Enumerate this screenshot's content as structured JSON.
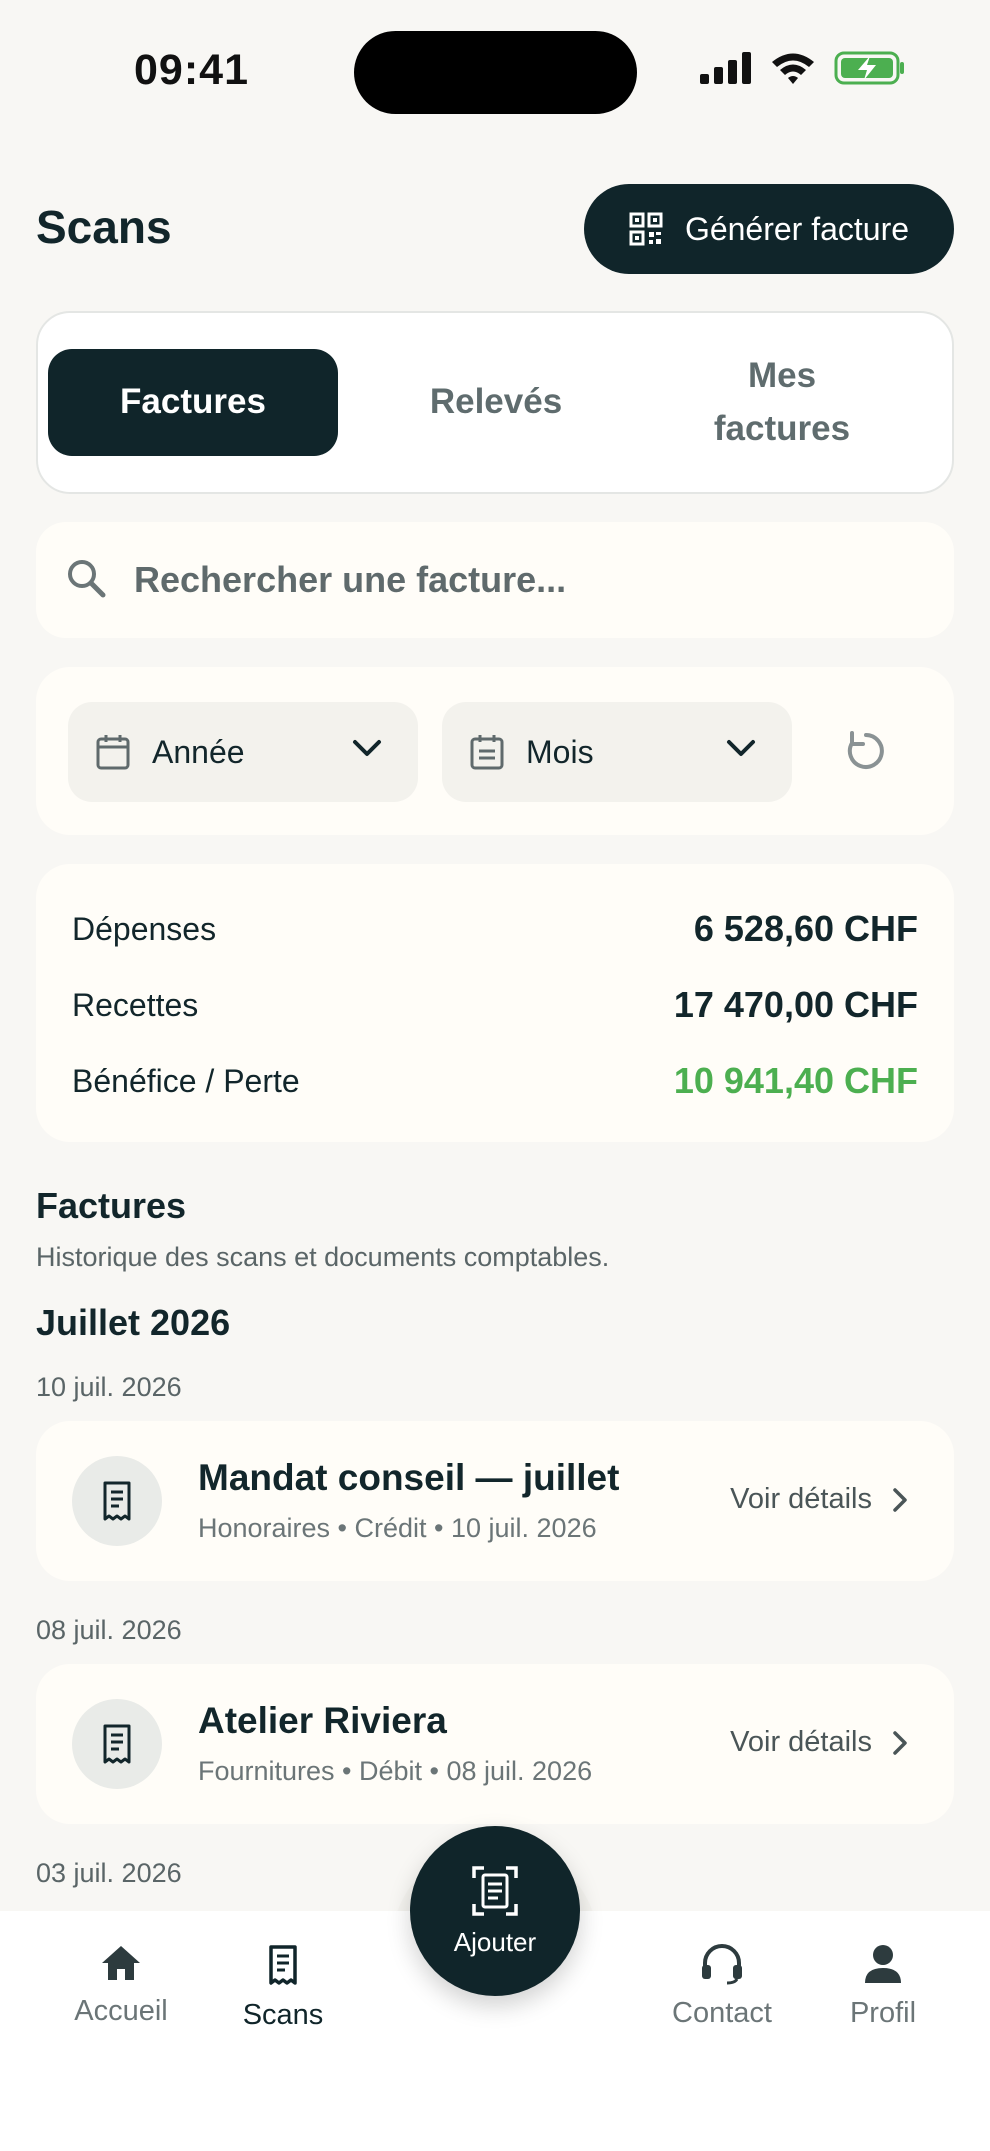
{
  "status": {
    "time": "09:41"
  },
  "header": {
    "title": "Scans",
    "generate_label": "Générer facture"
  },
  "tabs": [
    {
      "label": "Factures",
      "active": true
    },
    {
      "label": "Relevés",
      "active": false
    },
    {
      "label": "Mes factures",
      "active": false
    }
  ],
  "search": {
    "placeholder": "Rechercher une facture..."
  },
  "filters": {
    "year": "Année",
    "month": "Mois"
  },
  "summary": {
    "expenses_label": "Dépenses",
    "expenses_value": "6 528,60 CHF",
    "income_label": "Recettes",
    "income_value": "17 470,00 CHF",
    "profit_label": "Bénéfice / Perte",
    "profit_value": "10 941,40 CHF"
  },
  "section": {
    "title": "Factures",
    "subtitle": "Historique des scans et documents comptables.",
    "month": "Juillet 2026"
  },
  "groups": [
    {
      "date": "10 juil. 2026",
      "title": "Mandat conseil — juillet",
      "meta": "Honoraires • Crédit • 10 juil. 2026",
      "link": "Voir détails"
    },
    {
      "date": "08 juil. 2026",
      "title": "Atelier Riviera",
      "meta": "Fournitures • Débit • 08 juil. 2026",
      "link": "Voir détails"
    },
    {
      "date": "03 juil. 2026"
    }
  ],
  "nav": {
    "home": "Accueil",
    "scans": "Scans",
    "add": "Ajouter",
    "contact": "Contact",
    "profile": "Profil"
  },
  "colors": {
    "primary": "#10252a",
    "positive": "#4caf50",
    "background": "#f8f7f4"
  }
}
